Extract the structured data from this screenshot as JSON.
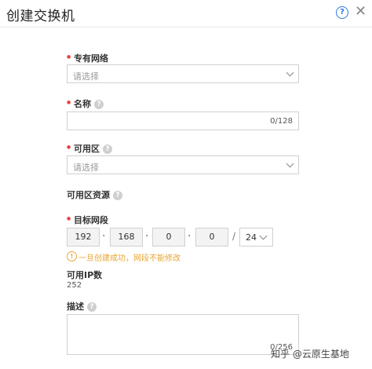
{
  "dialog": {
    "title": "创建交换机",
    "help_icon": "help-circle-icon",
    "close_icon": "close-icon"
  },
  "fields": {
    "vpc": {
      "label": "专有网络",
      "placeholder": "请选择"
    },
    "name": {
      "label": "名称",
      "counter": "0/128"
    },
    "zone": {
      "label": "可用区",
      "placeholder": "请选择"
    },
    "zone_resource": {
      "label": "可用区资源"
    },
    "cidr": {
      "label": "目标网段",
      "octets": [
        "192",
        "168",
        "0",
        "0"
      ],
      "separator": "/",
      "mask": "24",
      "warning": "一旦创建成功，网段不能修改"
    },
    "available_ip": {
      "label": "可用IP数",
      "value": "252"
    },
    "description": {
      "label": "描述",
      "counter": "0/256"
    }
  },
  "watermark": "知乎 @云原生基地",
  "colors": {
    "required": "#e84141",
    "warning": "#e8a532",
    "help": "#2a7ae2"
  }
}
